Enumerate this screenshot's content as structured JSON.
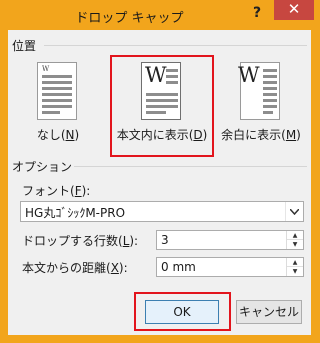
{
  "window": {
    "title": "ドロップ キャップ",
    "help_label": "?",
    "close_label": "✕"
  },
  "position": {
    "section_label": "位置",
    "options": [
      {
        "label_pre": "なし(",
        "key": "N",
        "label_post": ")",
        "icon": "no-dropcap-icon"
      },
      {
        "label_pre": "本文内に表示(",
        "key": "D",
        "label_post": ")",
        "icon": "dropped-in-text-icon",
        "selected": true
      },
      {
        "label_pre": "余白に表示(",
        "key": "M",
        "label_post": ")",
        "icon": "in-margin-icon"
      }
    ],
    "icon_letter": "W"
  },
  "options": {
    "section_label": "オプション",
    "font_label_pre": "フォント(",
    "font_key": "F",
    "font_label_post": "):",
    "font_value": "HG丸ｺﾞｼｯｸM-PRO",
    "lines_label_pre": "ドロップする行数(",
    "lines_key": "L",
    "lines_label_post": "):",
    "lines_value": "3",
    "distance_label_pre": "本文からの距離(",
    "distance_key": "X",
    "distance_label_post": "):",
    "distance_value": "0 mm"
  },
  "buttons": {
    "ok_label": "OK",
    "cancel_label": "キャンセル"
  },
  "colors": {
    "frame": "#f2a51c",
    "highlight": "#e2141c",
    "close": "#c74740"
  }
}
